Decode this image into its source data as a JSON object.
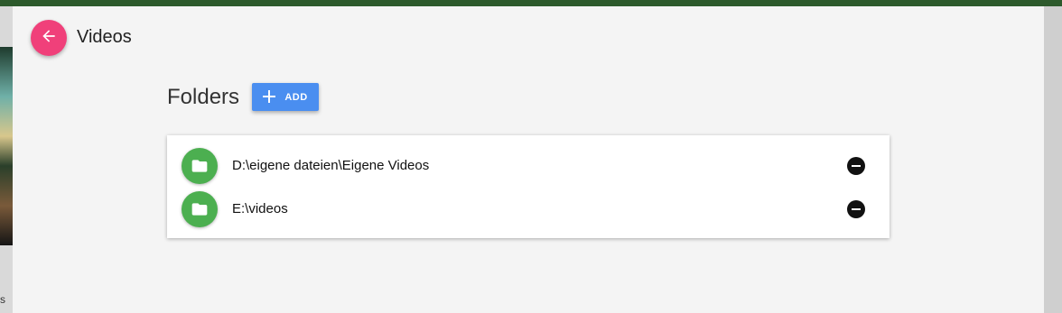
{
  "header": {
    "back_icon": "arrow-left-icon",
    "title": "Videos"
  },
  "folders_section": {
    "title": "Folders",
    "add_button": {
      "icon": "plus-icon",
      "label": "ADD"
    }
  },
  "folders": [
    {
      "path": "D:\\eigene dateien\\Eigene Videos",
      "icon": "folder-icon",
      "action_icon": "remove-circle-icon"
    },
    {
      "path": "E:\\videos",
      "icon": "folder-icon",
      "action_icon": "remove-circle-icon"
    }
  ],
  "background": {
    "partial_text": "s"
  },
  "colors": {
    "accent_pink": "#f0407a",
    "primary_blue": "#4a8ef0",
    "folder_green": "#4caf50",
    "topbar_green": "#2d5a2c"
  }
}
